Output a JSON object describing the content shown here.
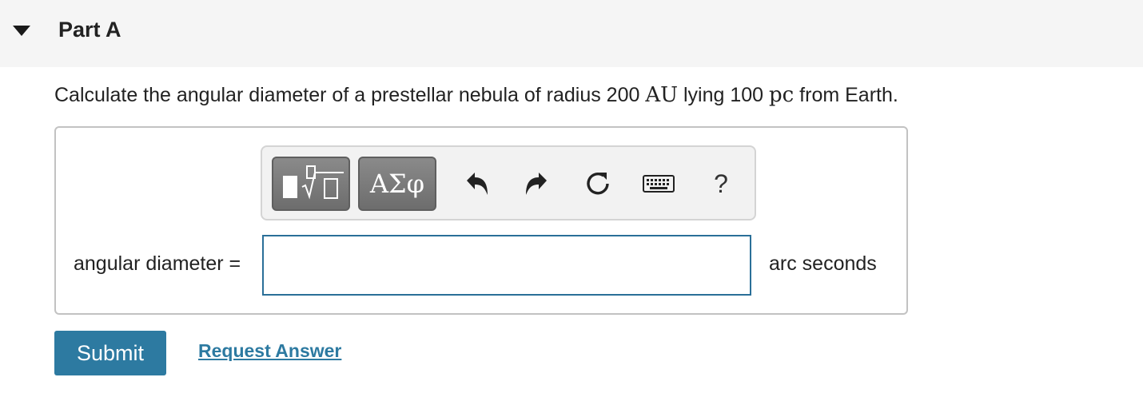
{
  "part": {
    "title": "Part A",
    "toggle_icon": "caret-down-icon"
  },
  "question": {
    "text_before": "Calculate the angular diameter of a prestellar nebula of radius 200 ",
    "unit_au": "AU",
    "text_middle": " lying 100 ",
    "unit_pc": "pc",
    "text_after": " from Earth."
  },
  "toolbar": {
    "template_icon": "templates-icon",
    "greek_label": "ΑΣφ",
    "undo_icon": "undo-icon",
    "redo_icon": "redo-icon",
    "reset_icon": "reset-icon",
    "keyboard_icon": "keyboard-icon",
    "help_label": "?"
  },
  "answer": {
    "label": "angular diameter =",
    "value": "",
    "units": "arc seconds"
  },
  "actions": {
    "submit_label": "Submit",
    "request_answer_label": "Request Answer"
  },
  "colors": {
    "primary": "#2d7aa1",
    "header_bg": "#f5f5f5",
    "input_border": "#2a6f98"
  }
}
